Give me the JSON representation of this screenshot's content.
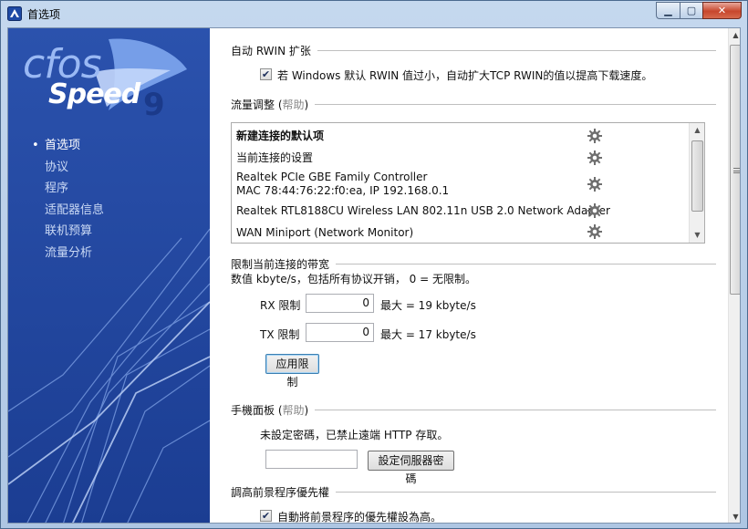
{
  "window": {
    "title": "首选项"
  },
  "logo": {
    "brand_top": "cfos",
    "brand_bottom": "Speed",
    "version": "9"
  },
  "nav": [
    {
      "label": "首选项",
      "active": true
    },
    {
      "label": "协议"
    },
    {
      "label": "程序"
    },
    {
      "label": "适配器信息"
    },
    {
      "label": "联机预算"
    },
    {
      "label": "流量分析"
    }
  ],
  "rwin": {
    "heading": "自动 RWIN 扩张",
    "checkbox_label": "若 Windows 默认 RWIN 值过小，自动扩大TCP RWIN的值以提高下载速度。",
    "checked": true
  },
  "traffic": {
    "heading": "流量调整",
    "help": "帮助",
    "items": [
      {
        "line1": "新建连接的默认项",
        "bold": true
      },
      {
        "line1": "当前连接的设置"
      },
      {
        "line1": "Realtek PCIe GBE Family Controller",
        "line2": "MAC 78:44:76:22:f0:ea, IP 192.168.0.1"
      },
      {
        "line1": "Realtek RTL8188CU Wireless LAN 802.11n USB 2.0 Network Adapter"
      },
      {
        "line1": "WAN Miniport (Network Monitor)"
      }
    ]
  },
  "bandwidth": {
    "heading": "限制当前连接的带宽",
    "desc": "数值 kbyte/s，包括所有协议开销， 0 = 无限制。",
    "rx_label": "RX 限制",
    "rx_value": "0",
    "rx_max": "最大 = 19 kbyte/s",
    "tx_label": "TX 限制",
    "tx_value": "0",
    "tx_max": "最大 = 17 kbyte/s",
    "apply": "应用限制"
  },
  "mobile": {
    "heading": "手機面板",
    "help": "帮助",
    "status": "未設定密碼，已禁止遠端 HTTP 存取。",
    "password_value": "",
    "set_button": "設定伺服器密碼"
  },
  "priority": {
    "heading": "調高前景程序優先權",
    "checkbox_label": "自動將前景程序的優先權設為高。",
    "checked": true
  }
}
